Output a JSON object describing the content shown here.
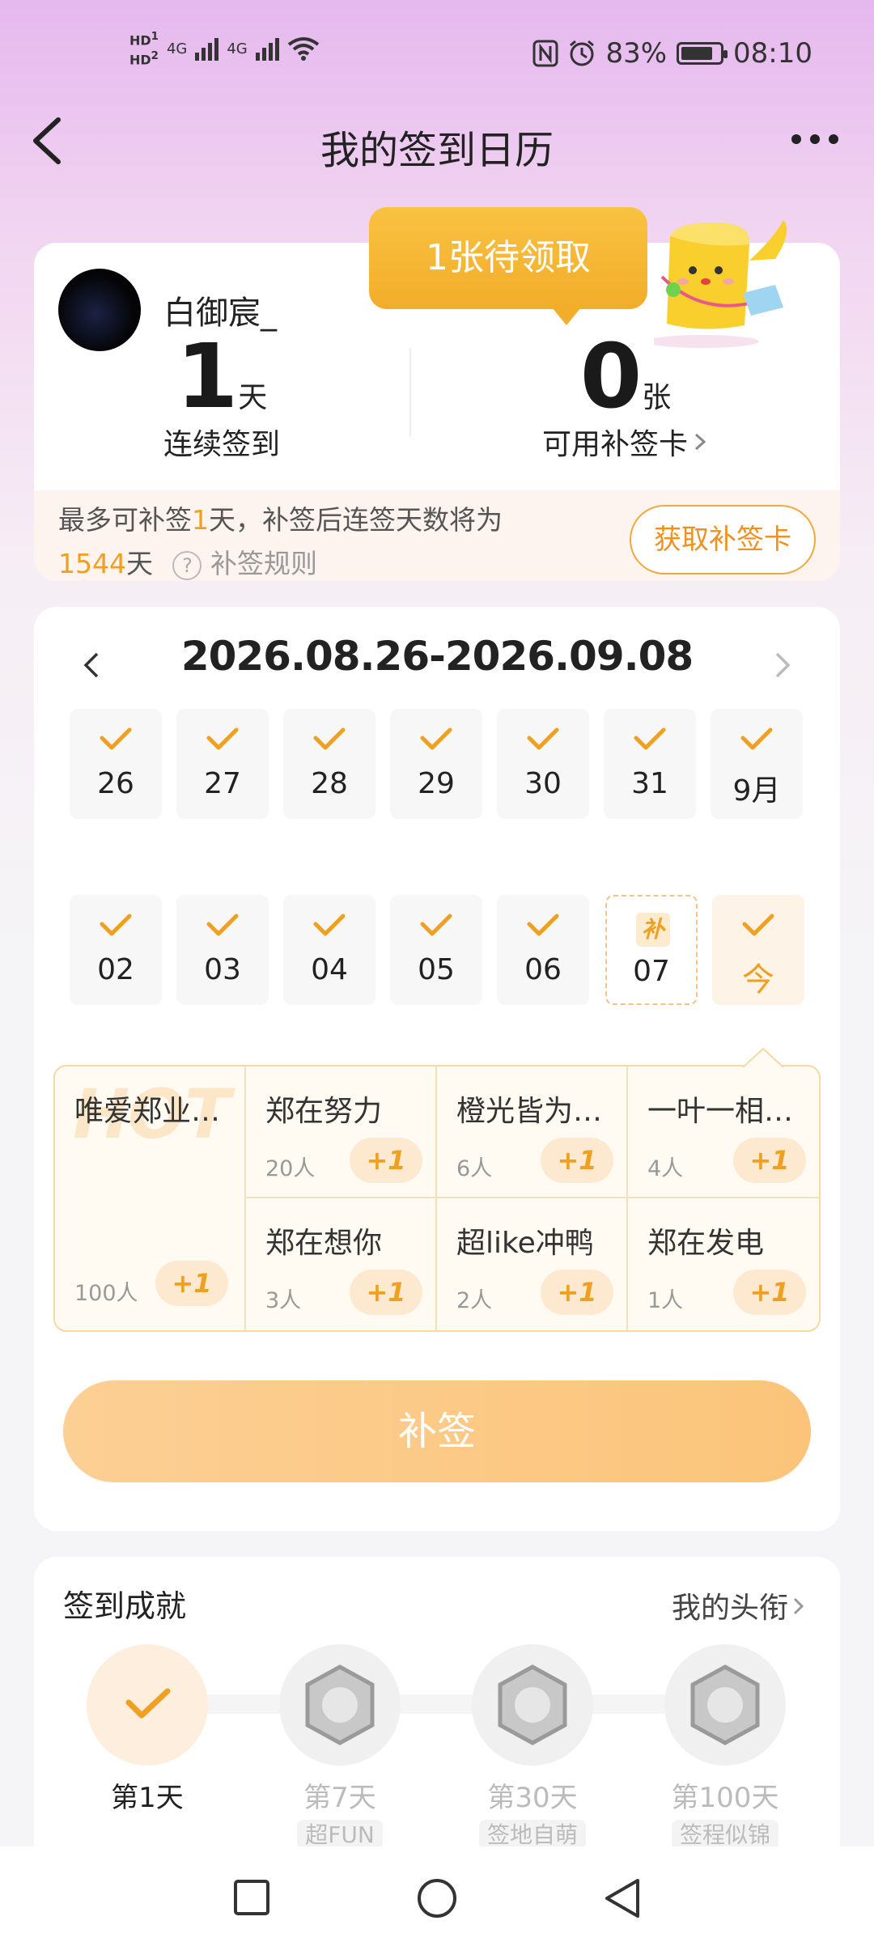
{
  "status_bar": {
    "network_left": "HD",
    "sim1": "1",
    "sim2": "2",
    "net1": "4G",
    "net2": "4G",
    "battery": "83%",
    "battery_level": 0.83,
    "time": "08:10"
  },
  "header": {
    "title": "我的签到日历"
  },
  "user": {
    "name": "白御宸_",
    "streak_value": "1",
    "streak_unit": "天",
    "streak_label": "连续签到",
    "cards_value": "0",
    "cards_unit": "张",
    "cards_label": "可用补签卡",
    "bubble": "1张待领取"
  },
  "makeup_info": {
    "line1_a": "最多可补签",
    "line1_num": "1",
    "line1_b": "天，补签后连签天数将为",
    "line2_num": "1544",
    "line2_unit": "天",
    "rules_icon": "?",
    "rules": "补签规则",
    "get_card_button": "获取补签卡"
  },
  "calendar": {
    "range": "2026.08.26-2026.09.08",
    "row1": [
      "26",
      "27",
      "28",
      "29",
      "30",
      "31",
      "9月"
    ],
    "row2": [
      "02",
      "03",
      "04",
      "05",
      "06"
    ],
    "makeup_day": "07",
    "makeup_mark": "补",
    "today": "今"
  },
  "groups": {
    "hot_watermark": "HOT",
    "featured": {
      "name": "唯爱郑业…",
      "count": "100人",
      "plus": "+1"
    },
    "items": [
      {
        "name": "郑在努力",
        "count": "20人",
        "plus": "+1"
      },
      {
        "name": "橙光皆为…",
        "count": "6人",
        "plus": "+1"
      },
      {
        "name": "一叶一相…",
        "count": "4人",
        "plus": "+1"
      },
      {
        "name": "郑在想你",
        "count": "3人",
        "plus": "+1"
      },
      {
        "name": "超like冲鸭",
        "count": "2人",
        "plus": "+1"
      },
      {
        "name": "郑在发电",
        "count": "1人",
        "plus": "+1"
      }
    ]
  },
  "makeup_button": "补签",
  "achievements": {
    "title": "签到成就",
    "my_titles": "我的头衔",
    "badges": [
      {
        "label": "第1天",
        "tag": "",
        "active": true
      },
      {
        "label": "第7天",
        "tag": "超FUN",
        "active": false
      },
      {
        "label": "第30天",
        "tag": "签地自萌",
        "active": false
      },
      {
        "label": "第100天",
        "tag": "签程似锦",
        "active": false
      }
    ]
  },
  "colors": {
    "accent": "#f0a020",
    "bubble": "#f5b431",
    "button": "#fbc67e"
  }
}
